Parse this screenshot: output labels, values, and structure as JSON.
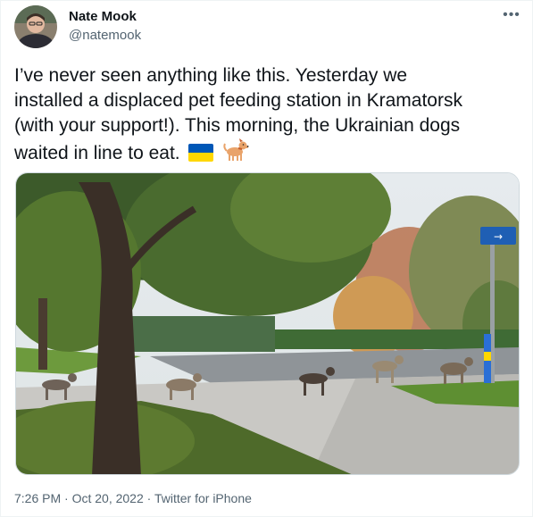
{
  "author": {
    "name": "Nate Mook",
    "handle": "@natemook",
    "avatar_icon": "avatar-photo"
  },
  "more_icon": "more-options-icon",
  "tweet": {
    "text_line1": "I’ve never seen anything like this. Yesterday we",
    "text_line2": "installed a displaced pet feeding station in Kramatorsk",
    "text_line3": "(with your support!). This morning, the Ukrainian dogs",
    "text_line4": "waited in line to eat.",
    "emojis": [
      "ukraine-flag-icon",
      "dog-icon"
    ]
  },
  "media": {
    "sign_text": "→",
    "icon": "photo-dogs-in-line"
  },
  "meta": {
    "time": "7:26 PM",
    "separator": "·",
    "date": "Oct 20, 2022",
    "source": "Twitter for iPhone"
  },
  "colors": {
    "text": "#0f1419",
    "secondary": "#536471",
    "ukraine_blue": "#0057b7",
    "ukraine_yellow": "#ffd700"
  }
}
